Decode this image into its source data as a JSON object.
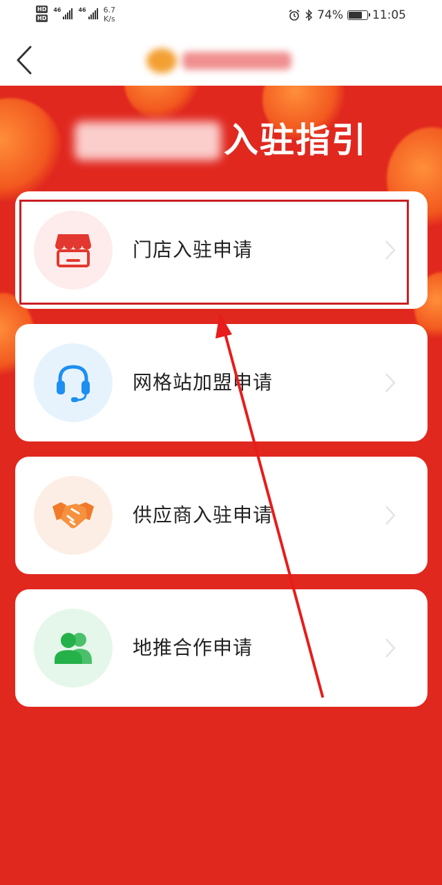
{
  "status_bar": {
    "hd1": "HD",
    "hd2": "HD",
    "signal1": "46",
    "signal2": "46",
    "speed_value": "6.7",
    "speed_unit": "K/s",
    "battery": "74%",
    "time": "11:05"
  },
  "nav": {
    "back_icon": "chevron-left-icon"
  },
  "hero": {
    "title_suffix": "入驻指引"
  },
  "cards": [
    {
      "label": "门店入驻申请",
      "icon": "storefront-icon",
      "icon_color": "#e2382f",
      "circle_color": "#fdeceb"
    },
    {
      "label": "网格站加盟申请",
      "icon": "headset-icon",
      "icon_color": "#1c8ff0",
      "circle_color": "#e6f3fd"
    },
    {
      "label": "供应商入驻申请",
      "icon": "handshake-icon",
      "icon_color": "#f07a2a",
      "circle_color": "#fdeee5"
    },
    {
      "label": "地推合作申请",
      "icon": "users-icon",
      "icon_color": "#24b14a",
      "circle_color": "#e4f7ea"
    }
  ],
  "colors": {
    "hero_red": "#e0281f",
    "annotation_red": "#c81e22"
  }
}
